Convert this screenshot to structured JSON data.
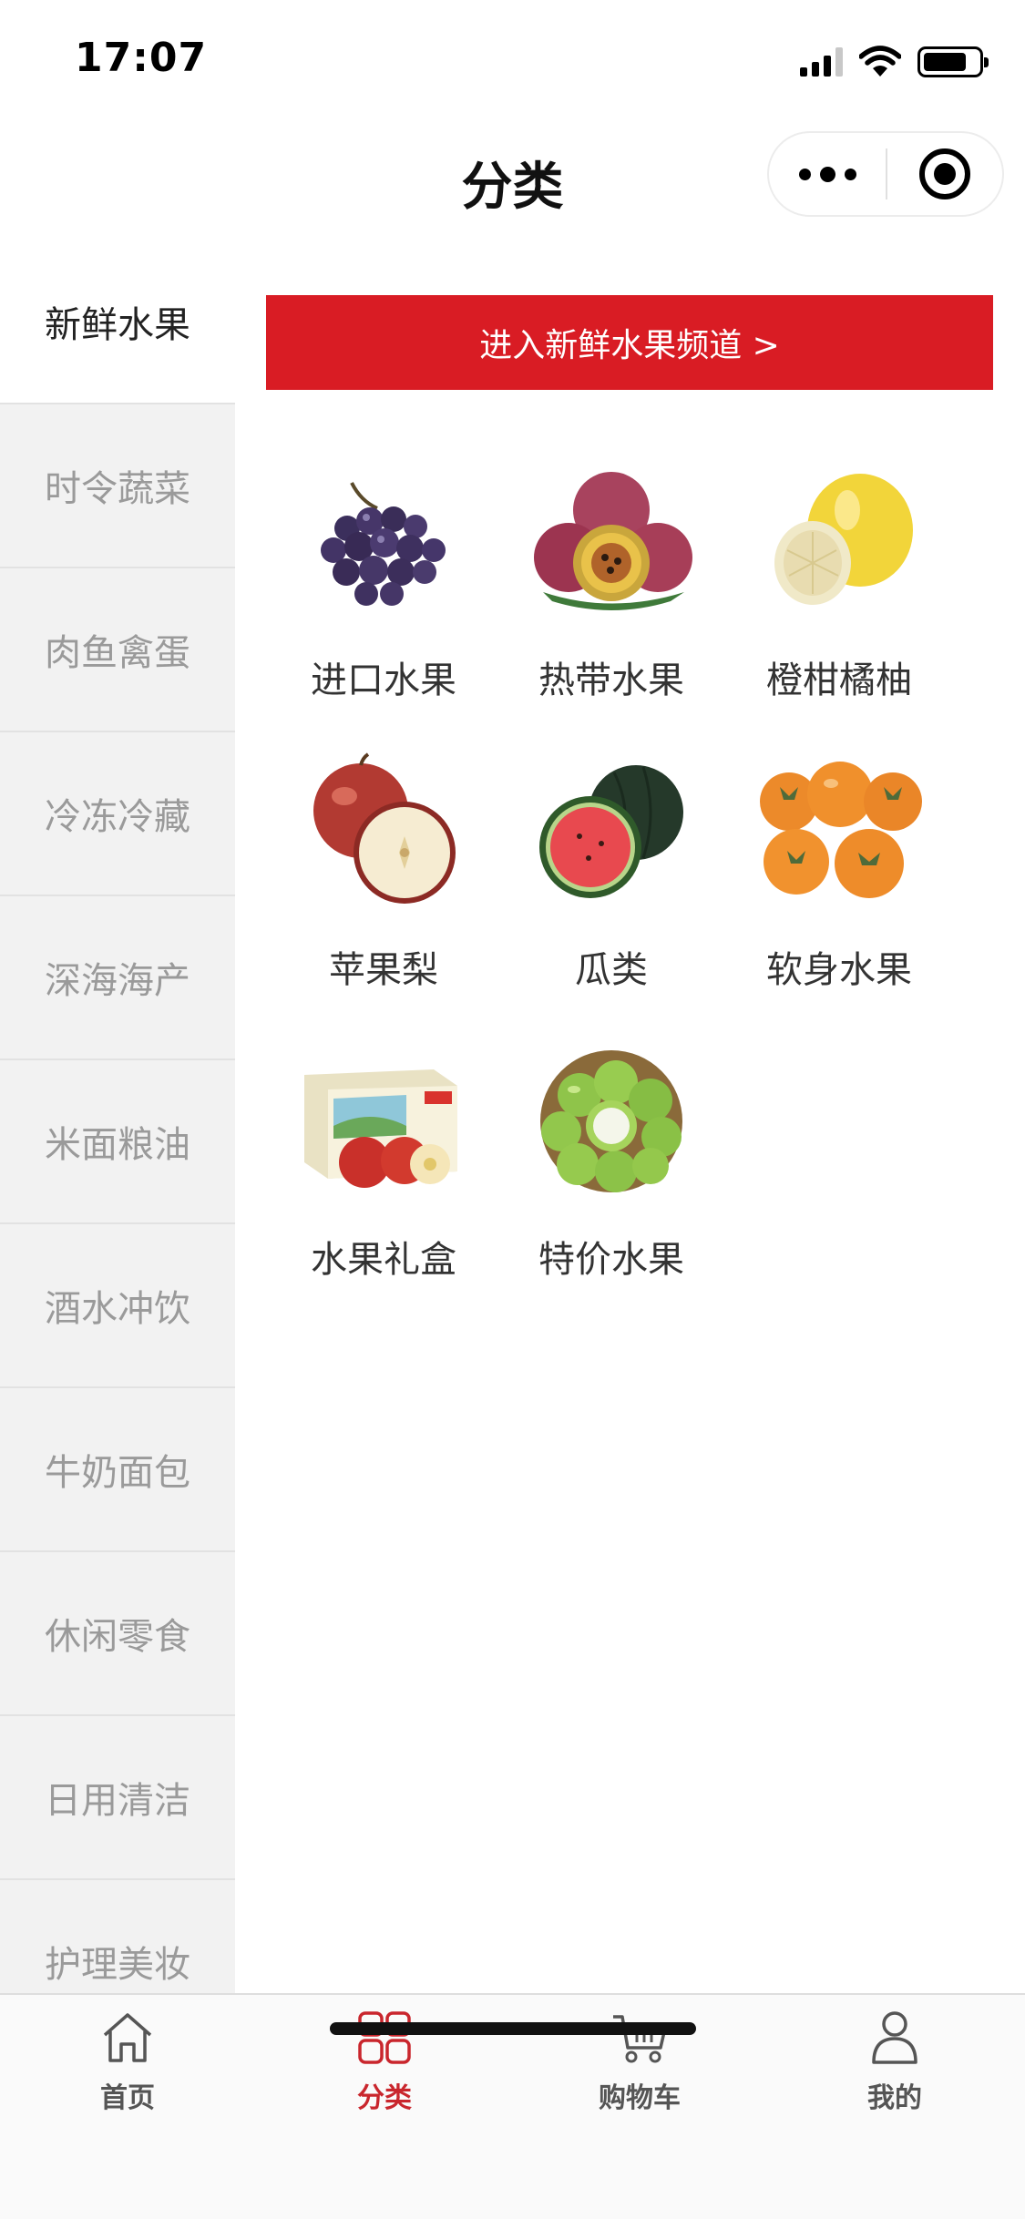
{
  "status_bar": {
    "time": "17:07"
  },
  "nav": {
    "title": "分类"
  },
  "sidebar": {
    "items": [
      {
        "label": "新鲜水果",
        "active": true
      },
      {
        "label": "时令蔬菜",
        "active": false
      },
      {
        "label": "肉鱼禽蛋",
        "active": false
      },
      {
        "label": "冷冻冷藏",
        "active": false
      },
      {
        "label": "深海海产",
        "active": false
      },
      {
        "label": "米面粮油",
        "active": false
      },
      {
        "label": "酒水冲饮",
        "active": false
      },
      {
        "label": "牛奶面包",
        "active": false
      },
      {
        "label": "休闲零食",
        "active": false
      },
      {
        "label": "日用清洁",
        "active": false
      },
      {
        "label": "护理美妆",
        "active": false
      }
    ]
  },
  "content": {
    "banner": "进入新鲜水果频道 >",
    "categories": [
      {
        "label": "进口水果",
        "icon": "grapes-image"
      },
      {
        "label": "热带水果",
        "icon": "passion-fruit-image"
      },
      {
        "label": "橙柑橘柚",
        "icon": "pomelo-image"
      },
      {
        "label": "苹果梨",
        "icon": "apple-image"
      },
      {
        "label": "瓜类",
        "icon": "watermelon-image"
      },
      {
        "label": "软身水果",
        "icon": "persimmon-image"
      },
      {
        "label": "水果礼盒",
        "icon": "gift-box-image"
      },
      {
        "label": "特价水果",
        "icon": "jujube-image"
      }
    ]
  },
  "tab_bar": {
    "tabs": [
      {
        "label": "首页",
        "icon": "home-icon",
        "active": false
      },
      {
        "label": "分类",
        "icon": "category-icon",
        "active": true
      },
      {
        "label": "购物车",
        "icon": "cart-icon",
        "active": false
      },
      {
        "label": "我的",
        "icon": "profile-icon",
        "active": false
      }
    ]
  },
  "colors": {
    "accent": "#d91c24",
    "active_tab": "#c9262d",
    "sidebar_bg": "#f2f2f2"
  }
}
